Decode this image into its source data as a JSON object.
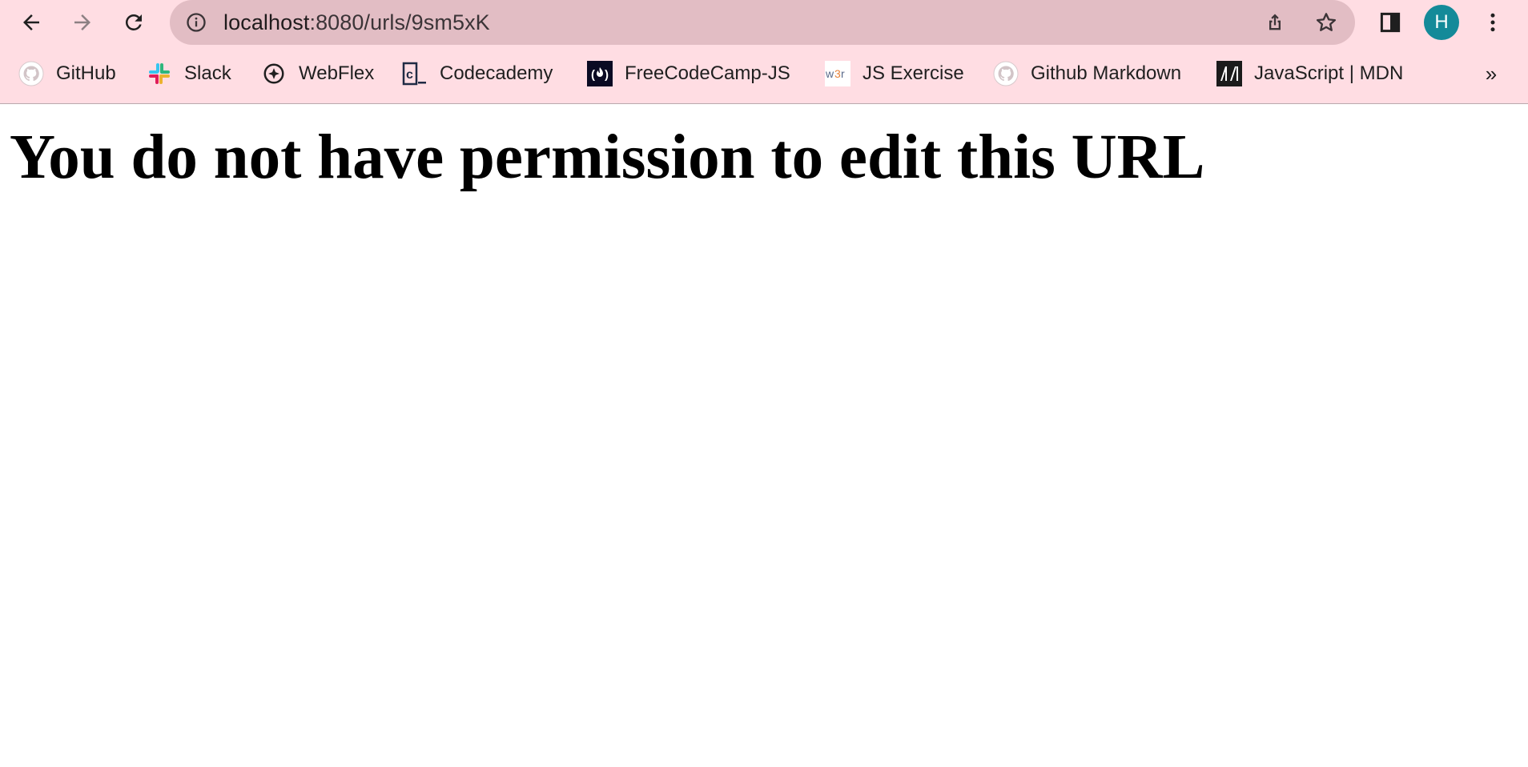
{
  "browser": {
    "address_bar": {
      "url_host": "localhost",
      "url_rest": ":8080/urls/9sm5xK"
    },
    "profile": {
      "initial": "H",
      "color": "#148a99"
    },
    "toolbar_icons": [
      "back-icon",
      "forward-icon",
      "reload-icon",
      "info-icon",
      "share-icon",
      "star-icon",
      "side-panel-icon",
      "kebab-menu-icon"
    ],
    "bookmarks": [
      {
        "label": "GitHub",
        "icon": "github-icon"
      },
      {
        "label": "Slack",
        "icon": "slack-icon"
      },
      {
        "label": "WebFlex",
        "icon": "webflex-icon"
      },
      {
        "label": "Codecademy",
        "icon": "codecademy-icon"
      },
      {
        "label": "FreeCodeCamp-JS",
        "icon": "freecodecamp-icon"
      },
      {
        "label": "JS Exercise",
        "icon": "w3resource-icon"
      },
      {
        "label": "Github Markdown",
        "icon": "github-icon"
      },
      {
        "label": "JavaScript | MDN",
        "icon": "mdn-icon"
      }
    ],
    "bookmarks_overflow": "»",
    "colors": {
      "chrome_background": "#ffdde3",
      "omnibox_background": "#e2bdc4"
    }
  },
  "page": {
    "heading": "You do not have permission to edit this URL"
  }
}
